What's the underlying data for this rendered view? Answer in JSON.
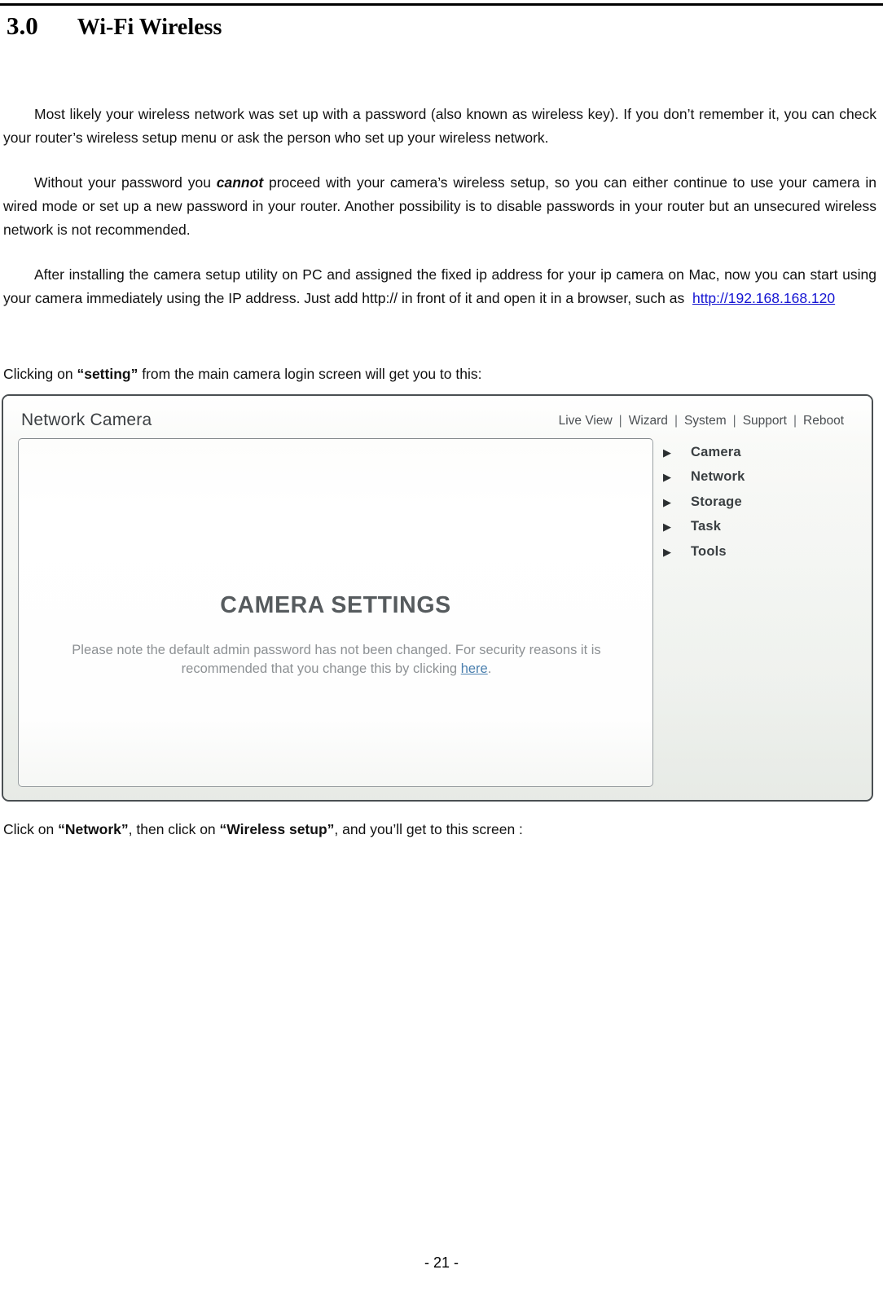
{
  "document": {
    "heading_number": "3.0",
    "heading_title": "Wi-Fi Wireless",
    "paragraph_1": "Most likely your wireless network was set up with a password (also known as wireless key). If you don’t remember it, you can check your router’s wireless setup menu or ask the person who set up your wireless network.",
    "paragraph_2_part1": "Without your password you ",
    "paragraph_2_emphasis": "cannot",
    "paragraph_2_part2": " proceed with your camera’s wireless setup, so you can either continue to use your camera in wired mode or set up a new password in your router. Another possibility is to disable passwords in your router but an unsecured wireless network is not recommended.",
    "paragraph_3_part1": "After installing the camera setup utility on PC and assigned the fixed ip address for your ip camera on Mac, now you can start using your camera immediately using the IP address. Just add http:// in front of it and open it in a browser, such as ",
    "paragraph_3_link": "http://192.168.168.120",
    "caption_before_part1": "Clicking on ",
    "caption_before_emphasis": "“setting”",
    "caption_before_part2": " from the main camera login screen will get you to this:",
    "caption_after_part1": "Click on ",
    "caption_after_emphasis_1": "“Network”",
    "caption_after_part2": ", then click on ",
    "caption_after_emphasis_2": "“Wireless setup”",
    "caption_after_part3": ", and you’ll get to this screen :",
    "page_number": "- 21 -"
  },
  "camera_ui": {
    "brand": "Network Camera",
    "nav": [
      {
        "label": "Live View"
      },
      {
        "label": "Wizard"
      },
      {
        "label": "System"
      },
      {
        "label": "Support"
      },
      {
        "label": "Reboot"
      }
    ],
    "nav_separator": "|",
    "panel": {
      "title": "CAMERA SETTINGS",
      "note_part1": "Please note the default admin password has not been changed. For security reasons it is recommended that you change this by clicking ",
      "note_link": "here",
      "note_part2": "."
    },
    "menu": [
      {
        "label": "Camera",
        "icon": "triangle-right-icon"
      },
      {
        "label": "Network",
        "icon": "triangle-right-icon"
      },
      {
        "label": "Storage",
        "icon": "triangle-right-icon"
      },
      {
        "label": "Task",
        "icon": "triangle-right-icon"
      },
      {
        "label": "Tools",
        "icon": "triangle-right-icon"
      }
    ],
    "menu_arrow_glyph": "▶",
    "colors": {
      "link": "#4a7fae",
      "title": "#565b5e",
      "note": "#8d9194",
      "frame_border": "#4a4f52"
    }
  }
}
